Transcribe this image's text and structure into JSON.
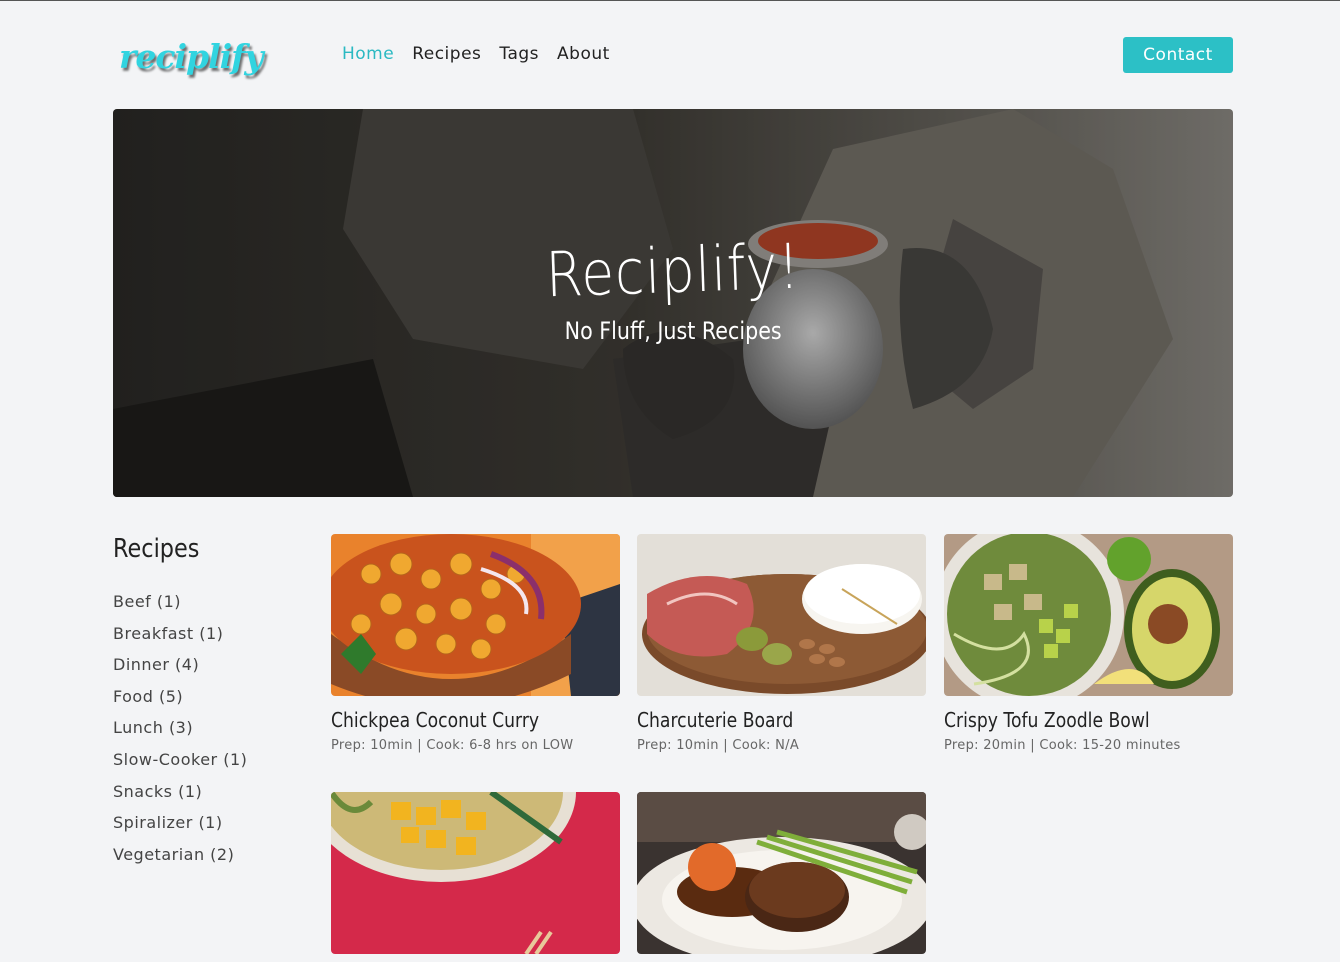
{
  "header": {
    "logo": "reciplify",
    "nav": [
      {
        "label": "Home",
        "active": true
      },
      {
        "label": "Recipes",
        "active": false
      },
      {
        "label": "Tags",
        "active": false
      },
      {
        "label": "About",
        "active": false
      }
    ],
    "contact_label": "Contact"
  },
  "hero": {
    "title": "Reciplify!",
    "subtitle": "No Fluff, Just Recipes"
  },
  "sidebar": {
    "heading": "Recipes",
    "tags": [
      "Beef (1)",
      "Breakfast (1)",
      "Dinner (4)",
      "Food (5)",
      "Lunch (3)",
      "Slow-Cooker (1)",
      "Snacks (1)",
      "Spiralizer (1)",
      "Vegetarian (2)"
    ]
  },
  "recipes": [
    {
      "title": "Chickpea Coconut Curry",
      "meta": "Prep: 10min | Cook: 6-8 hrs on LOW"
    },
    {
      "title": "Charcuterie Board",
      "meta": "Prep: 10min | Cook: N/A"
    },
    {
      "title": "Crispy Tofu Zoodle Bowl",
      "meta": "Prep: 20min | Cook: 15-20 minutes"
    },
    {
      "title": "",
      "meta": ""
    },
    {
      "title": "",
      "meta": ""
    }
  ],
  "colors": {
    "accent": "#2cc0c6",
    "logo": "#31d4e0",
    "background": "#f3f4f6"
  }
}
